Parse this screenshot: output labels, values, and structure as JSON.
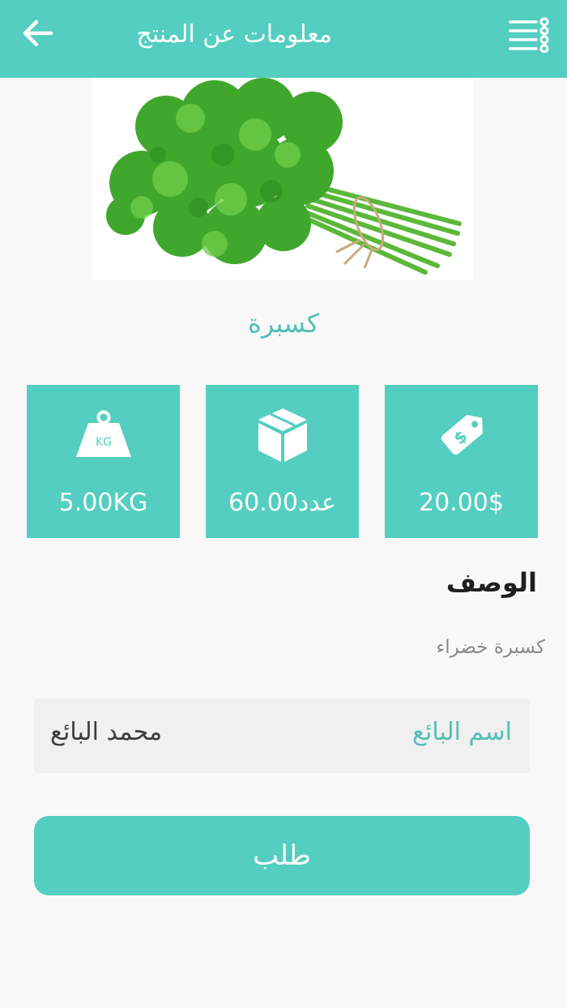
{
  "header": {
    "title": "معلومات عن المنتج",
    "back_icon": "arrow-left-icon",
    "menu_icon": "list-menu-icon"
  },
  "product": {
    "name": "كسبرة",
    "image_subject": "parsley-bunch"
  },
  "stats": {
    "price": {
      "icon": "price-tag-icon",
      "value": "20.00$"
    },
    "quantity": {
      "icon": "box-icon",
      "value": "60.00عدد"
    },
    "weight": {
      "icon": "weight-icon",
      "icon_text": "KG",
      "value": "5.00KG"
    }
  },
  "description": {
    "heading": "الوصف",
    "text": "كسبرة خضراء"
  },
  "seller": {
    "label": "اسم البائع",
    "name": "محمد البائع"
  },
  "order_button": {
    "label": "طلب"
  },
  "colors": {
    "accent": "#53cec0",
    "accent_text": "#53bfb4",
    "background": "#f8f8f8"
  }
}
